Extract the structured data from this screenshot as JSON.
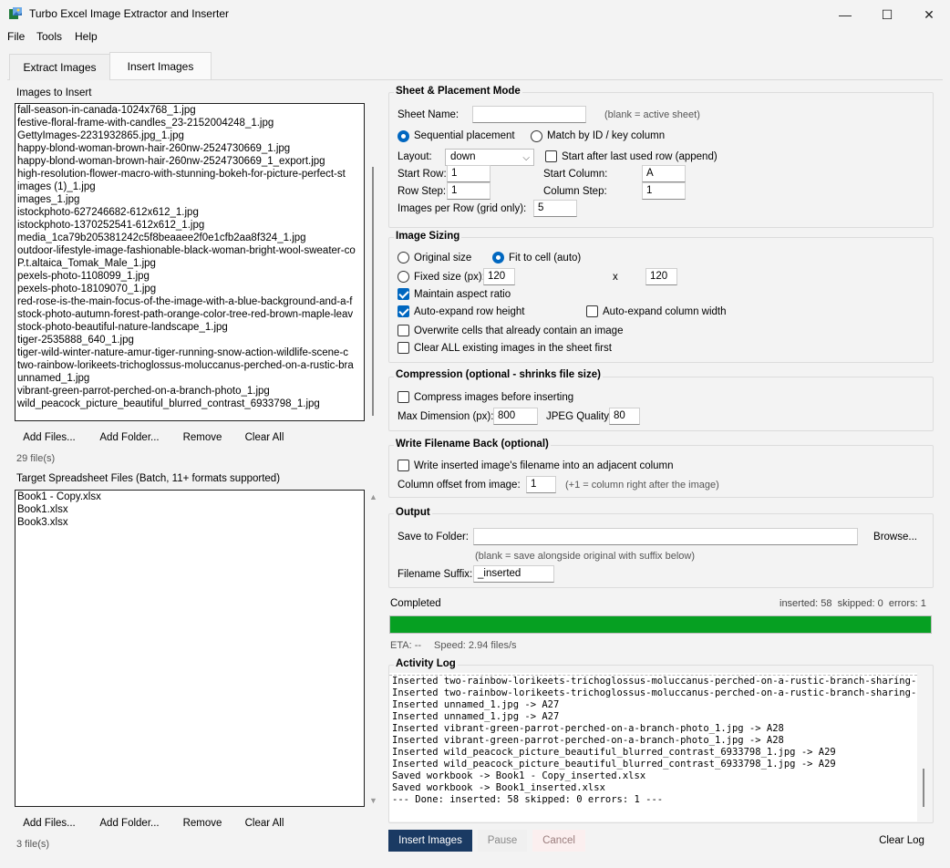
{
  "window": {
    "title": "Turbo Excel Image Extractor and Inserter",
    "minimize_glyph": "—",
    "maximize_glyph": "☐",
    "close_glyph": "✕"
  },
  "menu": [
    "File",
    "Tools",
    "Help"
  ],
  "tabs": [
    "Extract Images",
    "Insert Images"
  ],
  "images_panel": {
    "label": "Images to Insert",
    "files": [
      "fall-season-in-canada-1024x768_1.jpg",
      "festive-floral-frame-with-candles_23-2152004248_1.jpg",
      "GettyImages-2231932865.jpg_1.jpg",
      "happy-blond-woman-brown-hair-260nw-2524730669_1.jpg",
      "happy-blond-woman-brown-hair-260nw-2524730669_1_export.jpg",
      "high-resolution-flower-macro-with-stunning-bokeh-for-picture-perfect-st",
      "images (1)_1.jpg",
      "images_1.jpg",
      "istockphoto-627246682-612x612_1.jpg",
      "istockphoto-1370252541-612x612_1.jpg",
      "media_1ca79b205381242c5f8beaaee2f0e1cfb2aa8f324_1.jpg",
      "outdoor-lifestyle-image-fashionable-black-woman-bright-wool-sweater-co",
      "P.t.altaica_Tomak_Male_1.jpg",
      "pexels-photo-1108099_1.jpg",
      "pexels-photo-18109070_1.jpg",
      "red-rose-is-the-main-focus-of-the-image-with-a-blue-background-and-a-f",
      "stock-photo-autumn-forest-path-orange-color-tree-red-brown-maple-leav",
      "stock-photo-beautiful-nature-landscape_1.jpg",
      "tiger-2535888_640_1.jpg",
      "tiger-wild-winter-nature-amur-tiger-running-snow-action-wildlife-scene-c",
      "two-rainbow-lorikeets-trichoglossus-moluccanus-perched-on-a-rustic-bra",
      "unnamed_1.jpg",
      "vibrant-green-parrot-perched-on-a-branch-photo_1.jpg",
      "wild_peacock_picture_beautiful_blurred_contrast_6933798_1.jpg"
    ],
    "buttons": [
      "Add Files...",
      "Add Folder...",
      "Remove",
      "Clear All"
    ],
    "count": "29 file(s)"
  },
  "targets_panel": {
    "label": "Target Spreadsheet Files (Batch, 11+ formats supported)",
    "files": [
      "Book1 - Copy.xlsx",
      "Book1.xlsx",
      "Book3.xlsx"
    ],
    "buttons": [
      "Add Files...",
      "Add Folder...",
      "Remove",
      "Clear All"
    ],
    "count": "3 file(s)"
  },
  "placement": {
    "title": "Sheet & Placement Mode",
    "sheet_name_label": "Sheet Name:",
    "sheet_name_value": "",
    "sheet_hint": "(blank = active sheet)",
    "mode_sequential": "Sequential placement",
    "mode_match": "Match by ID / key column",
    "layout_label": "Layout:",
    "layout_value": "down",
    "append_label": "Start after last used row (append)",
    "start_row_label": "Start Row:",
    "start_row_value": "1",
    "start_col_label": "Start Column:",
    "start_col_value": "A",
    "row_step_label": "Row Step:",
    "row_step_value": "1",
    "col_step_label": "Column Step:",
    "col_step_value": "1",
    "per_row_label": "Images per Row (grid only):",
    "per_row_value": "5"
  },
  "sizing": {
    "title": "Image Sizing",
    "original": "Original size",
    "fit": "Fit to cell (auto)",
    "fixed": "Fixed size (px):",
    "fixed_w": "120",
    "x": "x",
    "fixed_h": "120",
    "aspect": "Maintain aspect ratio",
    "auto_row": "Auto-expand row height",
    "auto_col": "Auto-expand column width",
    "overwrite": "Overwrite cells that already contain an image",
    "clear_all": "Clear ALL existing images in the sheet first"
  },
  "compression": {
    "title": "Compression (optional - shrinks file size)",
    "compress": "Compress images before inserting",
    "max_dim_label": "Max Dimension (px):",
    "max_dim_value": "800",
    "jpeg_label": "JPEG Quality:",
    "jpeg_value": "80"
  },
  "write_back": {
    "title": "Write Filename Back (optional)",
    "write": "Write inserted image's filename into an adjacent column",
    "offset_label": "Column offset from image:",
    "offset_value": "1",
    "offset_hint": "(+1 = column right after the image)"
  },
  "output": {
    "title": "Output",
    "save_label": "Save to Folder:",
    "save_value": "",
    "browse": "Browse...",
    "save_hint": "(blank = save alongside original with suffix below)",
    "suffix_label": "Filename Suffix:",
    "suffix_value": "_inserted"
  },
  "status": {
    "state": "Completed",
    "counts": "inserted: 58  skipped: 0  errors: 1",
    "progress": 1.0,
    "eta": "ETA: --",
    "speed": "Speed: 2.94 files/s"
  },
  "log": {
    "title": "Activity Log",
    "lines": [
      "Inserted two-rainbow-lorikeets-trichoglossus-moluccanus-perched-on-a-rustic-branch-sharing-an-af",
      "Inserted two-rainbow-lorikeets-trichoglossus-moluccanus-perched-on-a-rustic-branch-sharing-an-af",
      "Inserted unnamed_1.jpg -> A27",
      "Inserted unnamed_1.jpg -> A27",
      "Inserted vibrant-green-parrot-perched-on-a-branch-photo_1.jpg -> A28",
      "Inserted vibrant-green-parrot-perched-on-a-branch-photo_1.jpg -> A28",
      "Inserted wild_peacock_picture_beautiful_blurred_contrast_6933798_1.jpg -> A29",
      "Inserted wild_peacock_picture_beautiful_blurred_contrast_6933798_1.jpg -> A29",
      "Saved workbook -> Book1 - Copy_inserted.xlsx",
      "Saved workbook -> Book1_inserted.xlsx",
      "--- Done: inserted: 58  skipped: 0  errors: 1 ---"
    ]
  },
  "actions": {
    "insert": "Insert Images",
    "pause": "Pause",
    "cancel": "Cancel",
    "clear_log": "Clear Log"
  },
  "colors": {
    "progress": "#06a022",
    "primary_button": "#1a3a63",
    "accent": "#0067c0"
  }
}
